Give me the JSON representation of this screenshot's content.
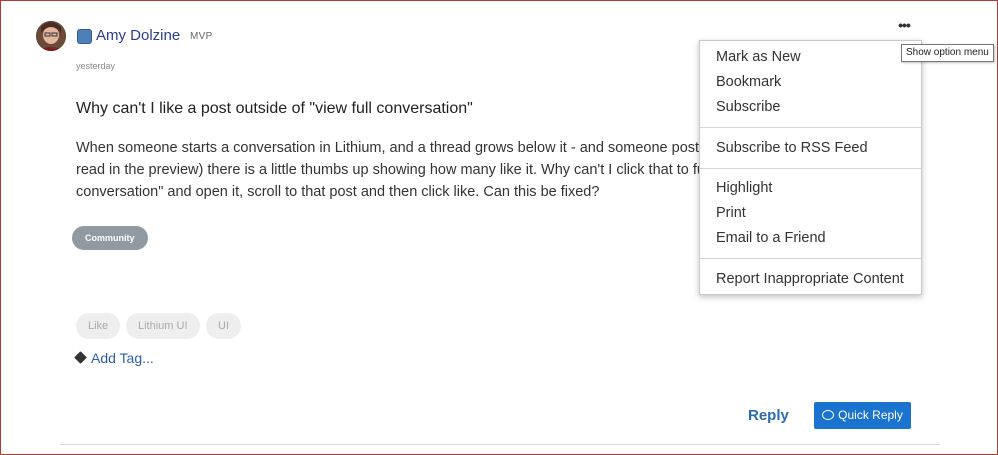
{
  "post": {
    "author": "Amy Dolzine",
    "rank": "MVP",
    "timestamp": "yesterday",
    "title": "Why can't I like a post outside of \"view full conversation\"",
    "body": "When someone starts a conversation in Lithium, and a thread grows below it - and someone post read in the preview) there is a little thumbs up showing how many like it. Why can't I click that to full conversation\" and open it, scroll to that post and then click like. Can this be fixed?",
    "board": "Community",
    "tags": [
      "Like",
      "Lithium UI",
      "UI"
    ],
    "add_tag": "Add Tag..."
  },
  "options": {
    "tooltip": "Show option menu",
    "menu": {
      "group1": [
        "Mark as New",
        "Bookmark",
        "Subscribe"
      ],
      "group2": [
        "Subscribe to RSS Feed"
      ],
      "group3": [
        "Highlight",
        "Print",
        "Email to a Friend"
      ],
      "group4": [
        "Report Inappropriate Content"
      ]
    }
  },
  "actions": {
    "reply": "Reply",
    "quick_reply": "Quick Reply"
  },
  "colors": {
    "author_link": "#2a3d8f",
    "quick_reply_bg": "#1b73d0",
    "board_badge_bg": "#8f9aa3",
    "frame_border": "#b53a3a"
  }
}
